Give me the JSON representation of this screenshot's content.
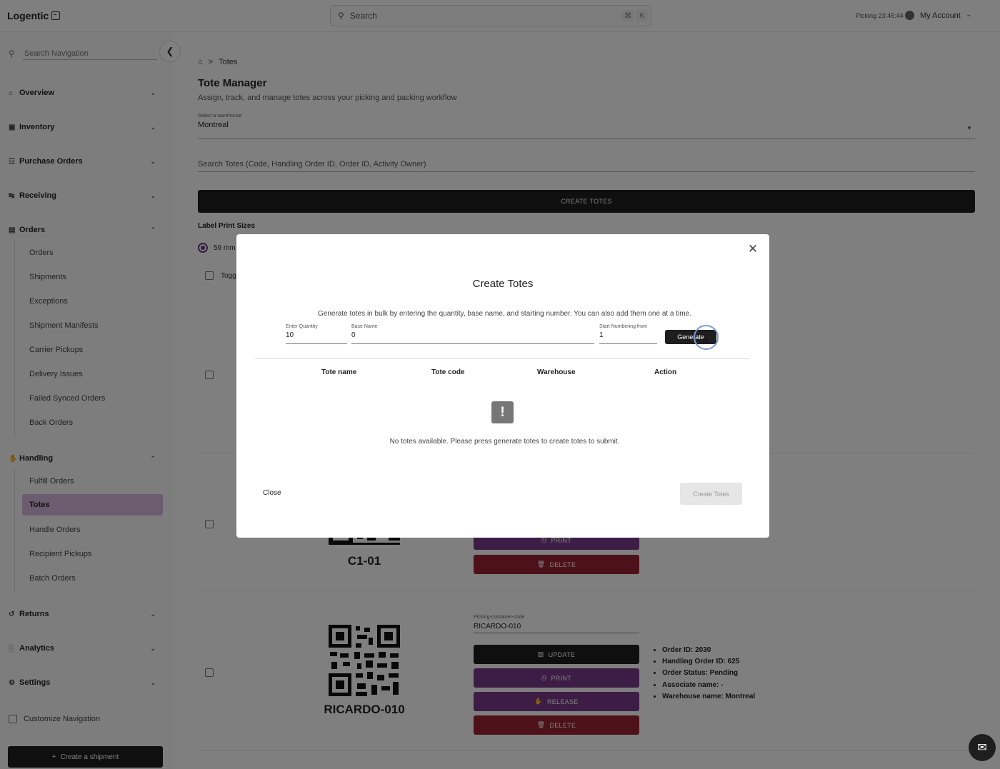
{
  "app": {
    "name": "Logentic"
  },
  "topbar": {
    "search_placeholder": "Search",
    "shortcut_cmd": "⌘",
    "shortcut_key": "K",
    "picking_timer": "Picking 23:45:44",
    "account_label": "My Account"
  },
  "sidebar": {
    "search_placeholder": "Search Navigation",
    "groups": [
      {
        "label": "Overview",
        "icon": "home-icon"
      },
      {
        "label": "Inventory",
        "icon": "box-icon"
      },
      {
        "label": "Purchase Orders",
        "icon": "cart-icon"
      },
      {
        "label": "Receiving",
        "icon": "inbox-icon"
      },
      {
        "label": "Orders",
        "icon": "document-icon"
      },
      {
        "label": "Handling",
        "icon": "hand-icon"
      },
      {
        "label": "Returns",
        "icon": "return-icon"
      },
      {
        "label": "Analytics",
        "icon": "chart-icon"
      },
      {
        "label": "Settings",
        "icon": "gear-icon"
      }
    ],
    "orders_items": [
      "Orders",
      "Shipments",
      "Exceptions",
      "Shipment Manifests",
      "Carrier Pickups",
      "Delivery Issues",
      "Failed Synced Orders",
      "Back Orders"
    ],
    "handling_items": [
      "Fulfill Orders",
      "Totes",
      "Handle Orders",
      "Recipient Pickups",
      "Batch Orders"
    ],
    "active_item": "Totes",
    "customize_label": "Customize Navigation",
    "create_shipment_label": "Create a shipment"
  },
  "main": {
    "breadcrumb_current": "Totes",
    "title": "Tote Manager",
    "subtitle": "Assign, track, and manage totes across your picking and packing workflow",
    "warehouse_label": "Select a warehouse",
    "warehouse_value": "Montreal",
    "search_placeholder": "Search Totes (Code, Handling Order ID, Order ID, Activity Owner)",
    "create_totes_label": "CREATE TOTES",
    "label_print_sizes": "Label Print Sizes",
    "print_size_option": "59 mm",
    "toggle_label": "Togg",
    "card1": {
      "code": "C1-01",
      "print_label": "PRINT",
      "delete_label": "DELETE"
    },
    "card2": {
      "field_label": "Picking-container-code",
      "field_value": "RICARDO-010",
      "code": "RICARDO-010",
      "update_label": "UPDATE",
      "print_label": "PRINT",
      "release_label": "RELEASE",
      "delete_label": "DELETE",
      "info": [
        "Order ID: 2030",
        "Handling Order ID: 625",
        "Order Status: Pending",
        "Associate name: -",
        "Warehouse name: Montreal"
      ]
    }
  },
  "modal": {
    "title": "Create Totes",
    "description": "Generate totes in bulk by entering the quantity, base name, and starting number. You can also add them one at a time.",
    "quantity_label": "Enter Quantity",
    "quantity_value": "10",
    "base_name_label": "Base Name",
    "base_name_value": "0",
    "start_label": "Start Numbering from",
    "start_value": "1",
    "generate_label": "Generate",
    "columns": [
      "Tote name",
      "Tote code",
      "Warehouse",
      "Action"
    ],
    "empty_message": "No totes available. Please press generate totes to create totes to submit.",
    "close_label": "Close",
    "create_label": "Create Totes"
  },
  "colors": {
    "accent_purple": "#7a3a8a",
    "active_nav_bg": "#d9b8de",
    "delete_red": "#9a2232",
    "dark": "#1e1e1e"
  }
}
